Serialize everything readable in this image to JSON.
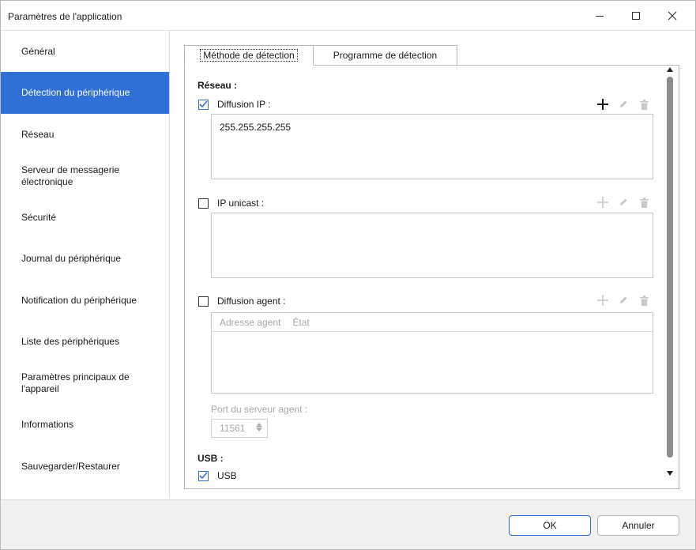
{
  "window": {
    "title": "Paramètres de l'application",
    "controls": {
      "minimize": "minimize-icon",
      "maximize": "maximize-icon",
      "close": "close-icon"
    }
  },
  "sidebar": {
    "items": [
      {
        "label": "Général",
        "active": false
      },
      {
        "label": "Détection du périphérique",
        "active": true
      },
      {
        "label": "Réseau",
        "active": false
      },
      {
        "label": "Serveur de messagerie électronique",
        "active": false
      },
      {
        "label": "Sécurité",
        "active": false
      },
      {
        "label": "Journal du périphérique",
        "active": false
      },
      {
        "label": "Notification du périphérique",
        "active": false
      },
      {
        "label": "Liste des périphériques",
        "active": false
      },
      {
        "label": "Paramètres principaux de l'appareil",
        "active": false
      },
      {
        "label": "Informations",
        "active": false
      },
      {
        "label": "Sauvegarder/Restaurer",
        "active": false
      }
    ],
    "active_color": "#2f6fd6"
  },
  "tabs": [
    {
      "label": "Méthode de détection",
      "active": true
    },
    {
      "label": "Programme de détection",
      "active": false
    }
  ],
  "network": {
    "heading": "Réseau :",
    "ip_broadcast": {
      "label": "Diffusion IP :",
      "checked": true,
      "addresses": [
        "255.255.255.255"
      ],
      "tools": [
        "add-icon",
        "edit-icon",
        "delete-icon"
      ]
    },
    "ip_unicast": {
      "label": "IP unicast :",
      "checked": false,
      "addresses": [],
      "tools": [
        "add-icon",
        "edit-icon",
        "delete-icon"
      ]
    },
    "agent_broadcast": {
      "label": "Diffusion agent :",
      "checked": false,
      "columns": [
        "Adresse agent",
        "État"
      ],
      "rows": [],
      "tools": [
        "add-icon",
        "edit-icon",
        "delete-icon"
      ]
    },
    "agent_port": {
      "label": "Port du serveur agent :",
      "value": "11561"
    }
  },
  "usb": {
    "heading": "USB :",
    "option": {
      "label": "USB",
      "checked": true
    }
  },
  "footer": {
    "ok_label": "OK",
    "cancel_label": "Annuler"
  }
}
